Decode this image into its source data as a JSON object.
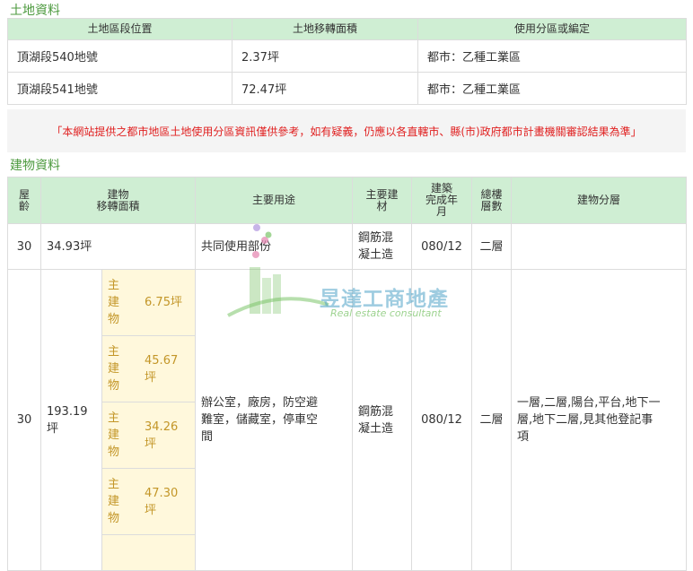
{
  "land": {
    "title": "土地資料",
    "headers": [
      "土地區段位置",
      "土地移轉面積",
      "使用分區或編定"
    ],
    "rows": [
      [
        "頂湖段540地號",
        "2.37坪",
        "都市：乙種工業區"
      ],
      [
        "頂湖段541地號",
        "72.47坪",
        "都市：乙種工業區"
      ]
    ]
  },
  "notice": "「本網站提供之都市地區土地使用分區資訊僅供參考，如有疑義，仍應以各直轄市、縣(市)政府都市計畫機關審認結果為準」",
  "building": {
    "title": "建物資料",
    "headers": {
      "age": "屋\n齡",
      "area": "建物\n移轉面積",
      "use": "主要用途",
      "material": "主要建\n材",
      "completed": "建築\n完成年\n月",
      "floors": "總樓\n層數",
      "layer": "建物分層"
    },
    "rows": [
      {
        "age": "30",
        "area": "34.93坪",
        "use": "共同使用部份",
        "material": "鋼筋混\n凝土造",
        "completed": "080/12",
        "floors": "二層",
        "layer": ""
      },
      {
        "age": "30",
        "area": "193.19\n坪",
        "use": "辦公室，廠房，防空避\n難室，儲藏室，停車空\n間",
        "material": "鋼筋混\n凝土造",
        "completed": "080/12",
        "floors": "二層",
        "layer": "一層,二層,陽台,平台,地下一\n層,地下二層,見其他登記事\n項",
        "sub": [
          {
            "label": "主\n建\n物",
            "value": "6.75坪"
          },
          {
            "label": "主\n建\n物",
            "value": "45.67\n坪"
          },
          {
            "label": "主\n建\n物",
            "value": "34.26\n坪"
          },
          {
            "label": "主\n建\n物",
            "value": "47.30\n坪"
          },
          {
            "label": "",
            "value": ""
          }
        ]
      }
    ]
  },
  "watermark": {
    "name": "昱達工商地產",
    "tagline": "Real estate consultant",
    "colors": {
      "green": "#7cc46a",
      "blue": "#4fa3c8",
      "pink": "#e58ab3",
      "purple": "#b49be0"
    }
  }
}
